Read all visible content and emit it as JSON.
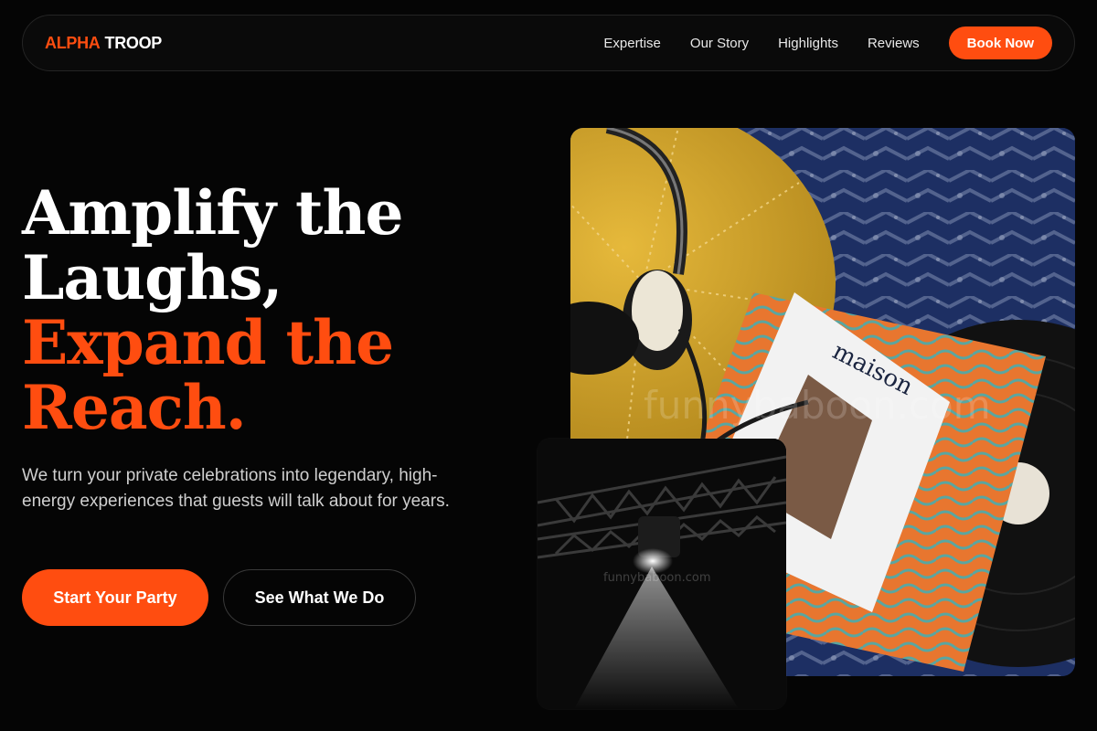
{
  "nav": {
    "logo_first": "ALPHA",
    "logo_second": "TROOP",
    "links": [
      "Expertise",
      "Our Story",
      "Highlights",
      "Reviews"
    ],
    "cta": "Book Now"
  },
  "hero": {
    "headline_white": [
      "Amplify the",
      "Laughs,"
    ],
    "headline_orange": [
      "Expand the",
      "Reach."
    ],
    "subtitle": "We turn your private celebrations into legendary, high-energy experiences that guests will talk about for years.",
    "primary_cta": "Start Your Party",
    "secondary_cta": "See What We Do"
  },
  "images": {
    "main_watermark": "funnybaboon.com",
    "small_watermark": "funnybaboon.com",
    "magazine_title": "maison"
  },
  "colors": {
    "accent": "#ff4d10",
    "background": "#050505"
  }
}
